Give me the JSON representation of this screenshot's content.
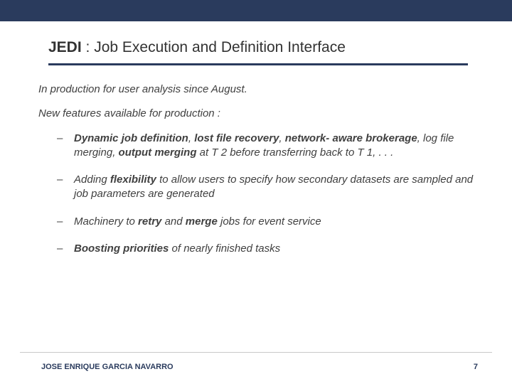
{
  "title": {
    "acronym": "JEDI",
    "rest": " : Job Execution and Definition Interface"
  },
  "lead1": "In production for user analysis since August.",
  "lead2": "New features available for production :",
  "bullets": {
    "b1": {
      "s1": "Dynamic job definition",
      "t1": ", ",
      "s2": "lost file recovery",
      "t2": ", ",
      "s3": "network- aware brokerage",
      "t3": ", log file merging, ",
      "s4": "output merging",
      "t4": " at T 2 before transferring back to T 1, . . ."
    },
    "b2": {
      "t1": "Adding ",
      "s1": "flexibility",
      "t2": " to allow users to specify how secondary datasets are sampled and job parameters are generated"
    },
    "b3": {
      "t1": "Machinery to ",
      "s1": "retry",
      "t2": " and ",
      "s2": "merge",
      "t3": " jobs for event service"
    },
    "b4": {
      "s1": "Boosting priorities",
      "t1": " of nearly finished tasks"
    }
  },
  "footer": {
    "author": "JOSE ENRIQUE GARCIA NAVARRO",
    "page": "7"
  }
}
